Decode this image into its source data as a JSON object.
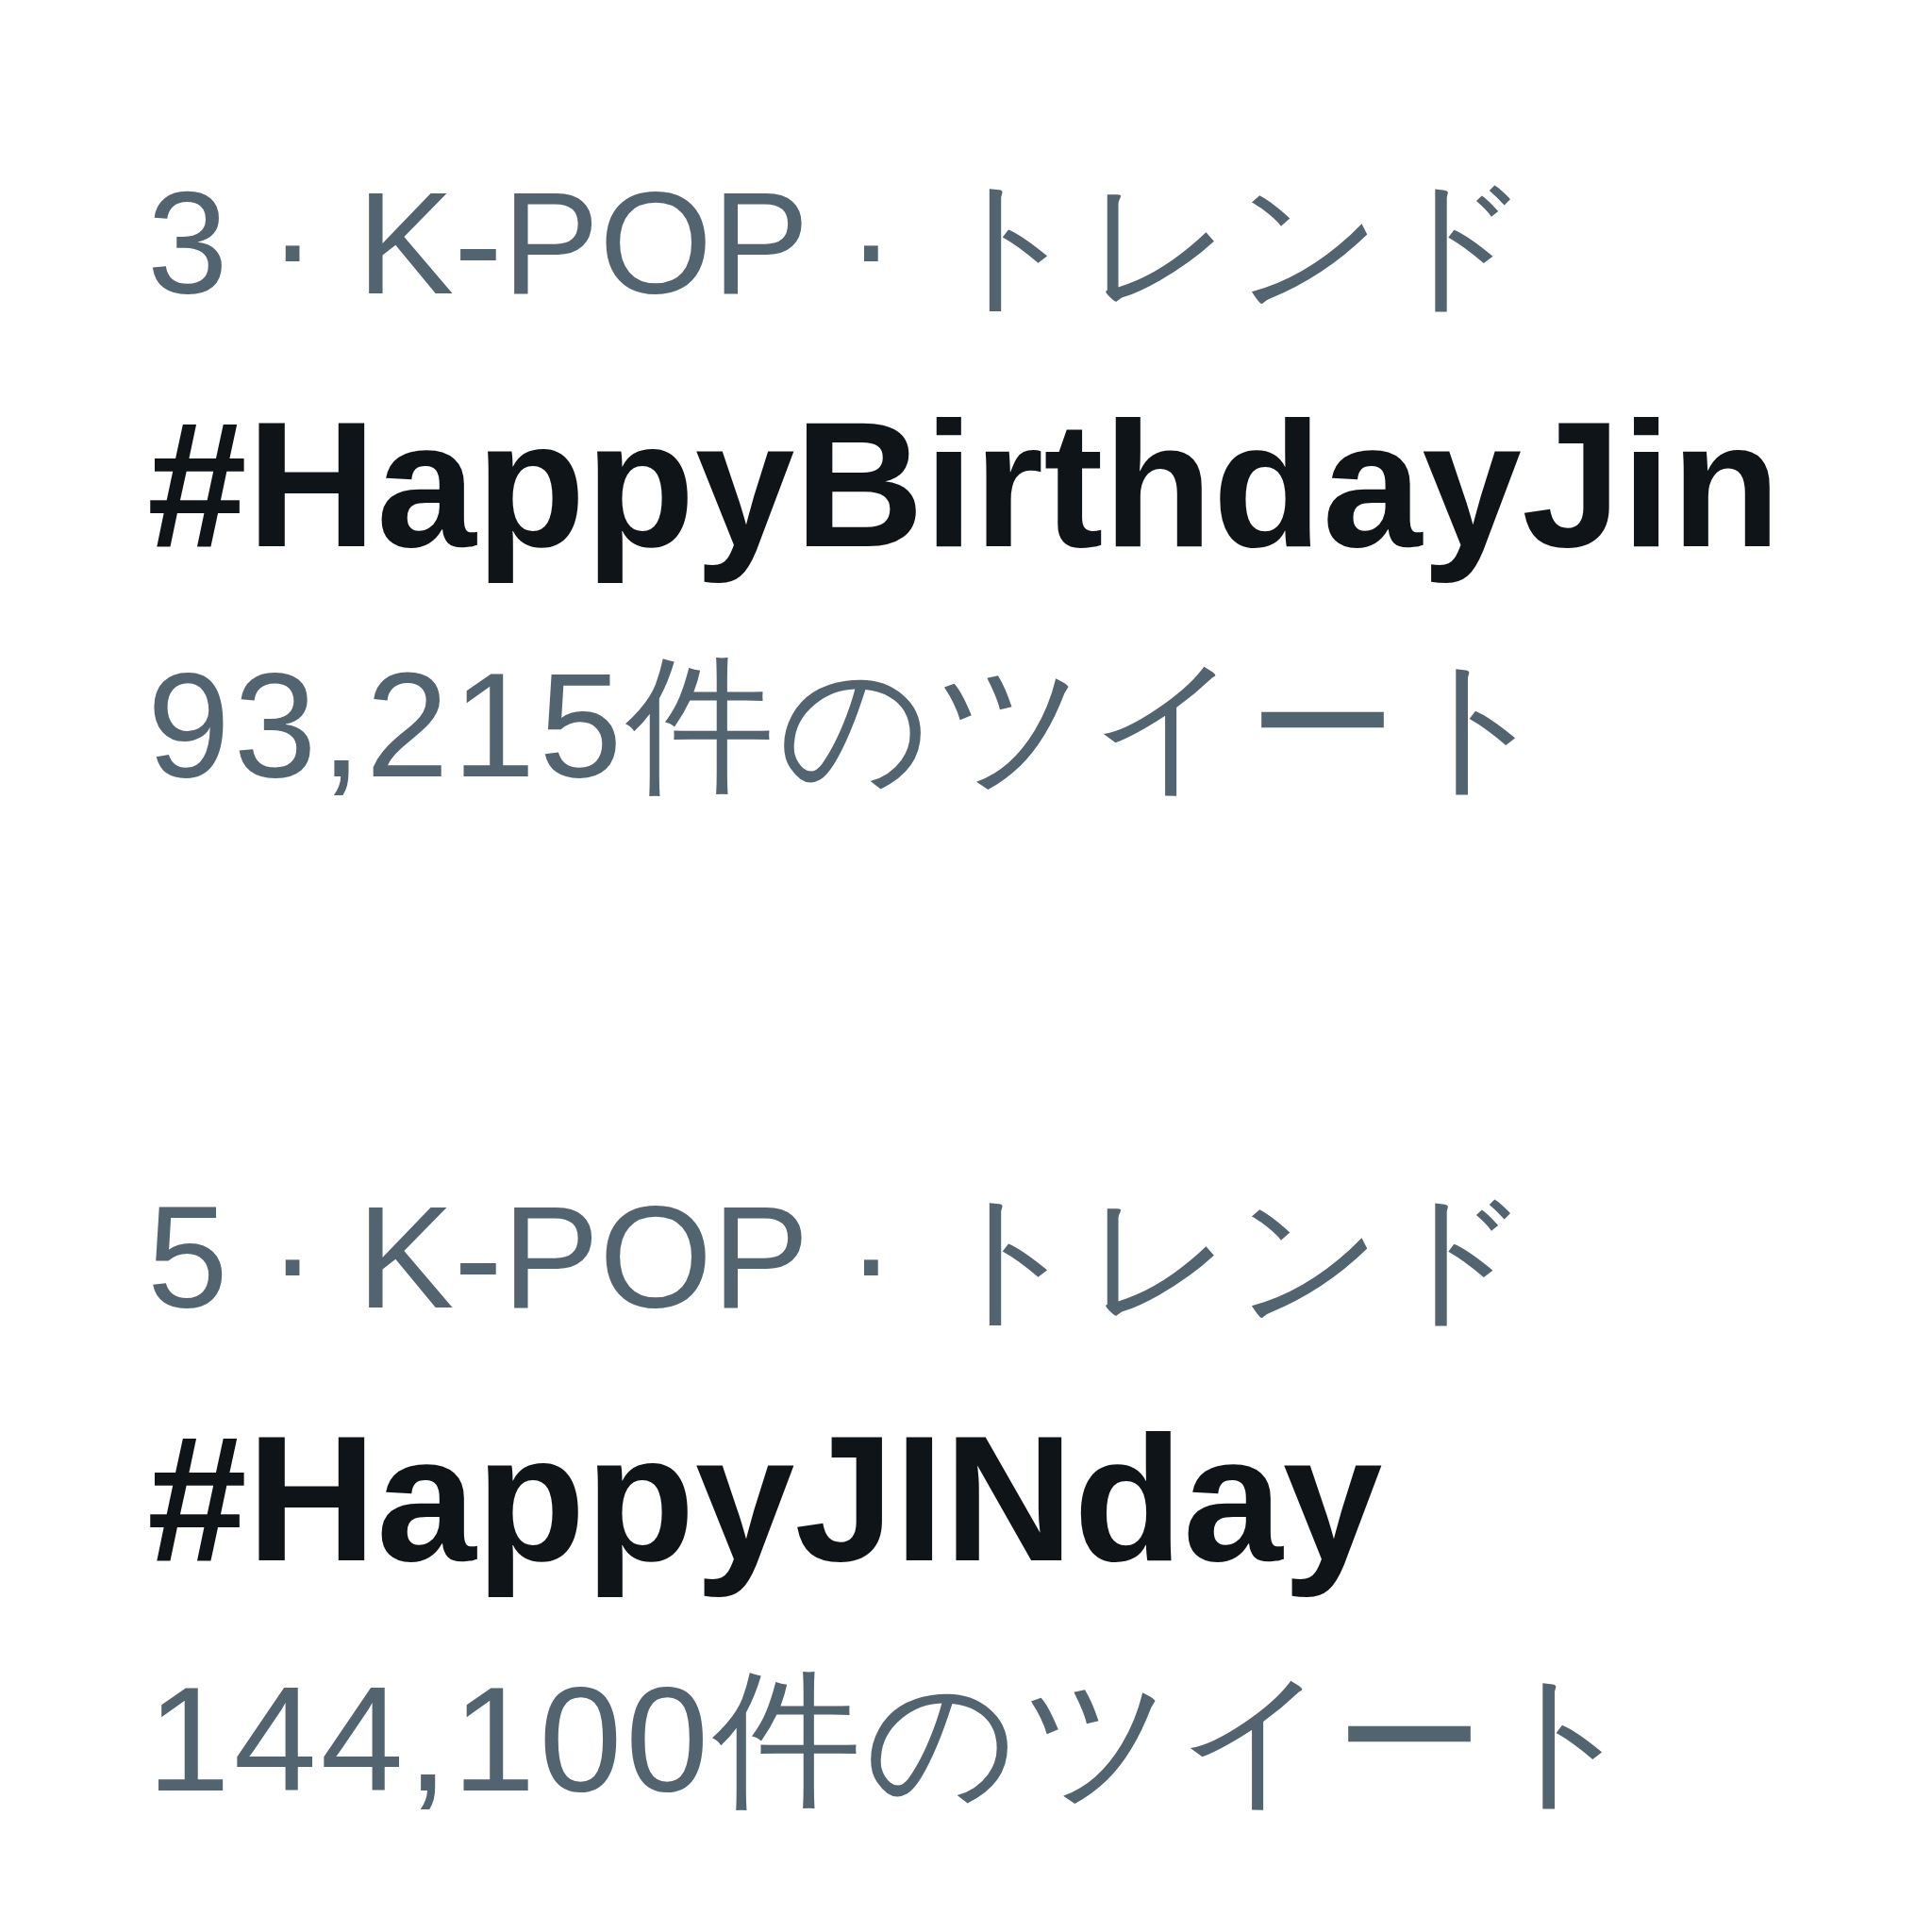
{
  "trends": [
    {
      "meta": "3 · K-POP · トレンド",
      "hashtag": "#HappyBirthdayJin",
      "count": "93,215件のツイート"
    },
    {
      "meta": "5 · K-POP · トレンド",
      "hashtag": "#HappyJINday",
      "count": "144,100件のツイート"
    }
  ]
}
